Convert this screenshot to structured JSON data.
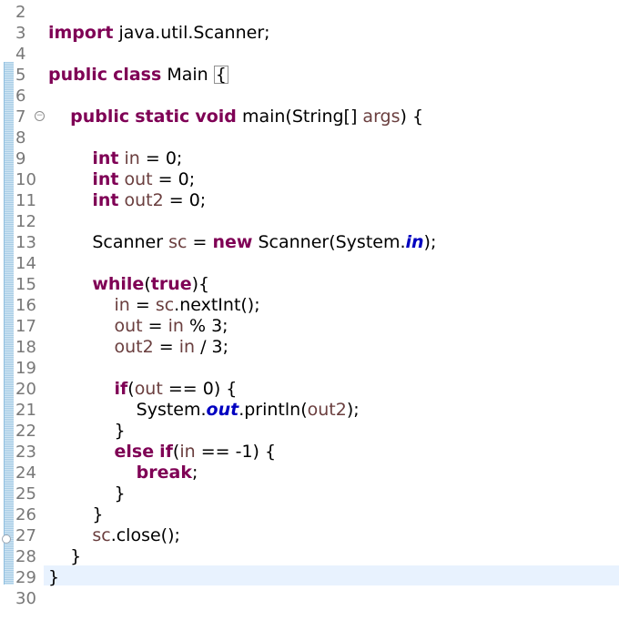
{
  "editor": {
    "language": "java",
    "current_line": "29",
    "colors": {
      "keyword": "#7f0055",
      "local_variable": "#6a3e3e",
      "static_field": "#0000c0",
      "line_number": "#787878",
      "current_line_highlight": "#e8f2fe",
      "change_bar": "#a9cde6"
    },
    "icons": {
      "fold": "fold-collapse-icon",
      "marker": "overview-marker-icon"
    },
    "lines": [
      {
        "n": "2",
        "code": ""
      },
      {
        "n": "3",
        "code": "import java.util.Scanner;"
      },
      {
        "n": "4",
        "code": ""
      },
      {
        "n": "5",
        "code": "public class Main {"
      },
      {
        "n": "6",
        "code": ""
      },
      {
        "n": "7",
        "code": "    public static void main(String[] args) {"
      },
      {
        "n": "8",
        "code": ""
      },
      {
        "n": "9",
        "code": "        int in = 0;"
      },
      {
        "n": "10",
        "code": "        int out = 0;"
      },
      {
        "n": "11",
        "code": "        int out2 = 0;"
      },
      {
        "n": "12",
        "code": ""
      },
      {
        "n": "13",
        "code": "        Scanner sc = new Scanner(System.in);"
      },
      {
        "n": "14",
        "code": ""
      },
      {
        "n": "15",
        "code": "        while(true){"
      },
      {
        "n": "16",
        "code": "            in = sc.nextInt();"
      },
      {
        "n": "17",
        "code": "            out = in % 3;"
      },
      {
        "n": "18",
        "code": "            out2 = in / 3;"
      },
      {
        "n": "19",
        "code": ""
      },
      {
        "n": "20",
        "code": "            if(out == 0) {"
      },
      {
        "n": "21",
        "code": "                System.out.println(out2);"
      },
      {
        "n": "22",
        "code": "            }"
      },
      {
        "n": "23",
        "code": "            else if(in == -1) {"
      },
      {
        "n": "24",
        "code": "                break;"
      },
      {
        "n": "25",
        "code": "            }"
      },
      {
        "n": "26",
        "code": "        }"
      },
      {
        "n": "27",
        "code": "        sc.close();"
      },
      {
        "n": "28",
        "code": "    }"
      },
      {
        "n": "29",
        "code": "}"
      },
      {
        "n": "30",
        "code": ""
      }
    ]
  }
}
